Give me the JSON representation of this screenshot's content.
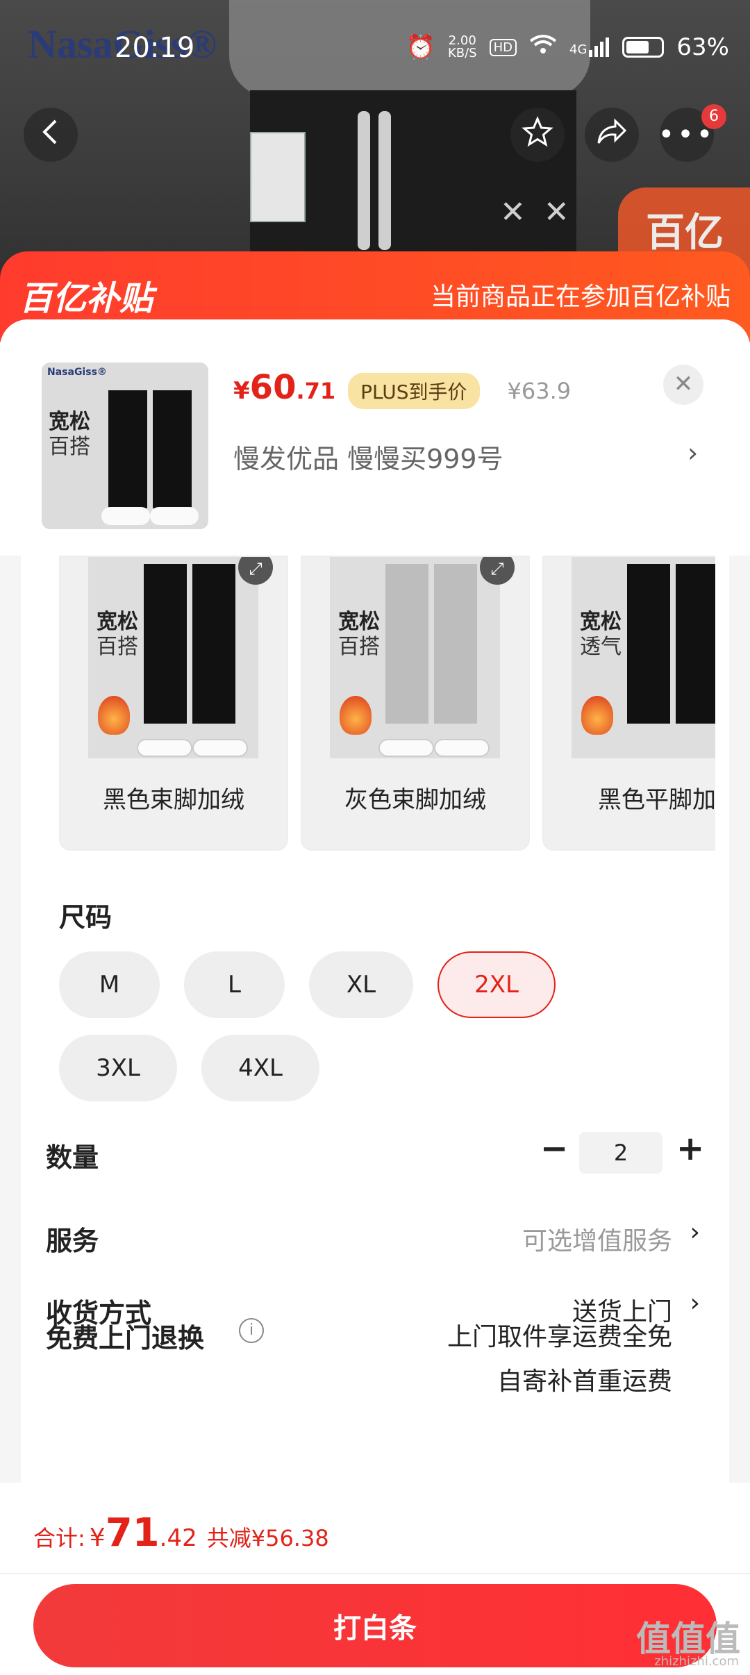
{
  "status_bar": {
    "time": "20:19",
    "net_speed": "2.00",
    "net_unit": "KB/S",
    "hd": "HD",
    "network": "4G",
    "battery": "63%"
  },
  "background": {
    "brand_text": "NasaGiss®",
    "corner_badge": "百亿"
  },
  "nav": {
    "back_icon": "chevron-left",
    "favorite_icon": "star",
    "share_icon": "share-arrow",
    "more_icon": "more-dots",
    "more_badge": "6"
  },
  "banner": {
    "logo": "百亿补贴",
    "text": "当前商品正在参加百亿补贴"
  },
  "product": {
    "thumb_brand": "NasaGiss®",
    "thumb_line1": "宽松",
    "thumb_line2": "百搭",
    "price_symbol": "¥",
    "price_int": "60",
    "price_dec": ".71",
    "plus_tag": "PLUS到手价",
    "original_price": "¥63.9",
    "address": "慢发优品  慢慢买999号"
  },
  "variants": [
    {
      "line1": "宽松",
      "line2": "百搭",
      "label": "黑色束脚加绒",
      "color": "#111111"
    },
    {
      "line1": "宽松",
      "line2": "百搭",
      "label": "灰色束脚加绒",
      "color": "#bdbdbd"
    },
    {
      "line1": "宽松",
      "line2": "透气",
      "label": "黑色平脚加",
      "color": "#111111"
    }
  ],
  "size": {
    "title": "尺码",
    "options": [
      "M",
      "L",
      "XL",
      "2XL",
      "3XL",
      "4XL"
    ],
    "selected": "2XL"
  },
  "quantity": {
    "label": "数量",
    "value": "2",
    "minus": "−",
    "plus": "+"
  },
  "service": {
    "label": "服务",
    "value": "可选增值服务"
  },
  "delivery": {
    "label": "收货方式",
    "value": "送货上门"
  },
  "return_service": {
    "label": "免费上门退换",
    "line1": "上门取件享运费全免",
    "line2": "自寄补首重运费"
  },
  "footer": {
    "total_label": "合计:",
    "total_symbol": "¥",
    "total_int": "71",
    "total_dec": ".42",
    "saved": "共减¥56.38",
    "pay_button": "打白条"
  },
  "watermark": {
    "main": "值值值",
    "sub": "zhizhizhi.com"
  },
  "colors": {
    "accent": "#e2231a",
    "banner": "#ff4a25",
    "plus_tag": "#f9e3a3"
  }
}
